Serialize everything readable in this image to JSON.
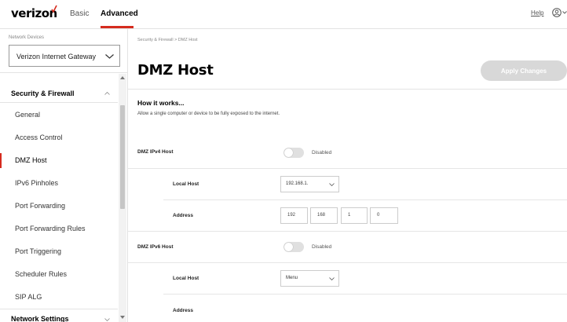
{
  "header": {
    "logo": "verizon",
    "tabs": [
      {
        "label": "Basic"
      },
      {
        "label": "Advanced"
      }
    ],
    "help_label": "Help",
    "accent_color": "#d52b1e"
  },
  "sidebar": {
    "device_label": "Network Devices",
    "device_select": "Verizon Internet Gateway",
    "section_title": "Security & Firewall",
    "items": [
      {
        "label": "General"
      },
      {
        "label": "Access Control"
      },
      {
        "label": "DMZ Host"
      },
      {
        "label": "IPv6 Pinholes"
      },
      {
        "label": "Port Forwarding"
      },
      {
        "label": "Port Forwarding Rules"
      },
      {
        "label": "Port Triggering"
      },
      {
        "label": "Scheduler Rules"
      },
      {
        "label": "SIP ALG"
      }
    ],
    "active_item": "DMZ Host",
    "next_section_title": "Network Settings"
  },
  "main": {
    "breadcrumb": "Security & Firewall  >  DMZ Host",
    "title": "DMZ Host",
    "apply_label": "Apply Changes",
    "how_title": "How it works...",
    "how_desc": "Allow a single computer or device to be fully exposed to the internet.",
    "ipv4": {
      "label": "DMZ IPv4 Host",
      "toggle_state": "Disabled",
      "local_host_label": "Local Host",
      "local_host_value": "192.168.1.",
      "address_label": "Address",
      "address": [
        "192",
        "168",
        "1",
        "0"
      ]
    },
    "ipv6": {
      "label": "DMZ IPv6 Host",
      "toggle_state": "Disabled",
      "local_host_label": "Local Host",
      "local_host_value": "Menu",
      "address_label": "Address"
    }
  }
}
